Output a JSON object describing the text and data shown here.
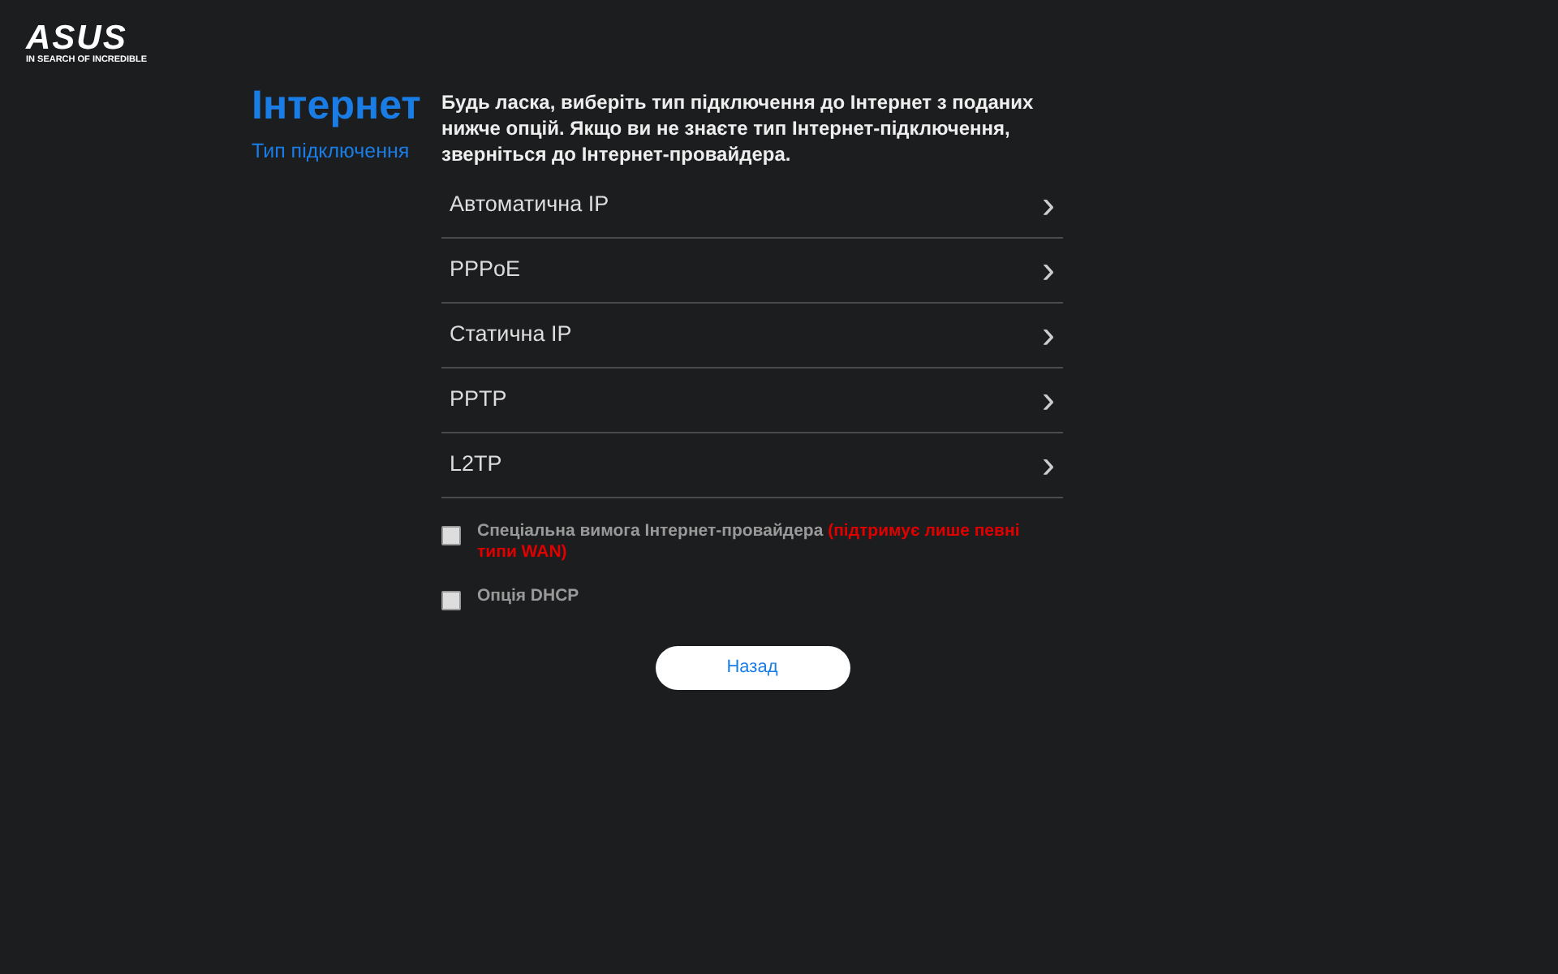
{
  "logo": {
    "brand": "ASUS",
    "tagline": "IN SEARCH OF INCREDIBLE"
  },
  "heading": {
    "title": "Інтернет",
    "subtitle": "Тип підключення"
  },
  "description": "Будь ласка, виберіть тип підключення до Інтернет з поданих нижче опцій. Якщо ви не знаєте тип Інтернет-підключення, зверніться до Інтернет-провайдера.",
  "connection_types": [
    {
      "label": "Автоматична IP",
      "arrow": "›"
    },
    {
      "label": "PPPoE",
      "arrow": "›"
    },
    {
      "label": "Статична IP",
      "arrow": "›"
    },
    {
      "label": "PPTP",
      "arrow": "›"
    },
    {
      "label": "L2TP",
      "arrow": "›"
    }
  ],
  "options": [
    {
      "label": "Спеціальна вимога Інтернет-провайдера",
      "note": "(підтримує лише певні типи WAN)",
      "checked": false
    },
    {
      "label": "Опція DHCP",
      "checked": false
    }
  ],
  "back_button": "Назад"
}
